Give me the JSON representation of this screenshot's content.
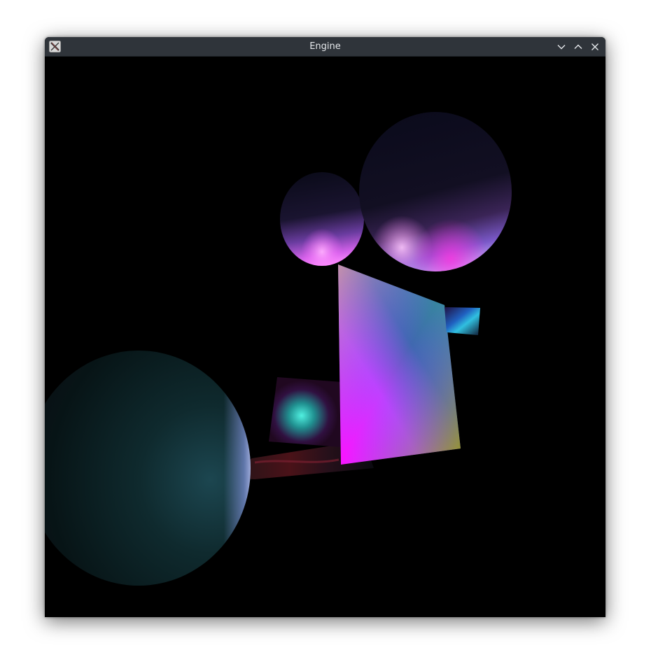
{
  "window": {
    "title": "Engine",
    "icons": {
      "app": "x-app-icon",
      "minimize": "chevron-down-icon",
      "maximize": "chevron-up-icon",
      "close": "close-icon"
    },
    "colors": {
      "titlebar": "#2f343a",
      "title_text": "#e6e9ec",
      "viewport": "#000000"
    }
  },
  "scene": {
    "objects": [
      "large-teal-sphere",
      "purple-sphere-small",
      "purple-sphere-large",
      "gradient-quad",
      "cyan-textured-quad",
      "small-blue-textured-quad",
      "dark-floor-plane"
    ],
    "colors": {
      "magenta": "#ff20ff",
      "teal": "#40c8c0",
      "yellow_green": "#a8a010",
      "violet_highlight": "#ff80ff",
      "periwinkle": "#a0a8ff"
    }
  }
}
